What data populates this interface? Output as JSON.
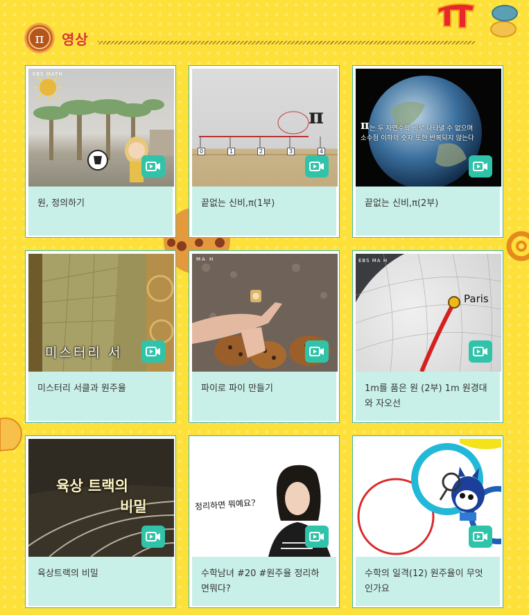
{
  "section": {
    "icon_symbol": "π",
    "title": "영상"
  },
  "videos": [
    {
      "title": "원, 정의하기",
      "thumb": {
        "logo": "EBS MATH"
      }
    },
    {
      "title": "끝없는 신비,π(1부)",
      "thumb": {
        "symbol": "π",
        "ruler_labels": [
          "0",
          "1",
          "2",
          "3",
          "4"
        ]
      }
    },
    {
      "title": "끝없는 신비,π(2부)",
      "thumb": {
        "symbol": "π",
        "overlay_line1": "는 두 자연수의 비로 나타낼 수 없으며",
        "overlay_line2": "소수점 이하의 숫자 또한 반복되지 않는다"
      }
    },
    {
      "title": "미스터리 서클과 원주율",
      "thumb": {
        "overlay": "미스터리 서"
      }
    },
    {
      "title": "파이로 파이 만들기",
      "thumb": {
        "logo": "MA H"
      }
    },
    {
      "title": "1m를 품은 원 (2부) 1m 원경대와 자오선",
      "thumb": {
        "logo": "EBS MA H",
        "place": "Paris"
      }
    },
    {
      "title": "육상트랙의 비밀",
      "thumb": {
        "overlay_line1": "육상 트랙의",
        "overlay_line2": "비밀"
      }
    },
    {
      "title": "수학남녀 #20 #원주율 정리하면뭐다?",
      "thumb": {
        "overlay": "정리하면 뭐예요?"
      }
    },
    {
      "title": "수학의 일격(12) 원주율이 무엇인가요",
      "thumb": {}
    }
  ]
}
